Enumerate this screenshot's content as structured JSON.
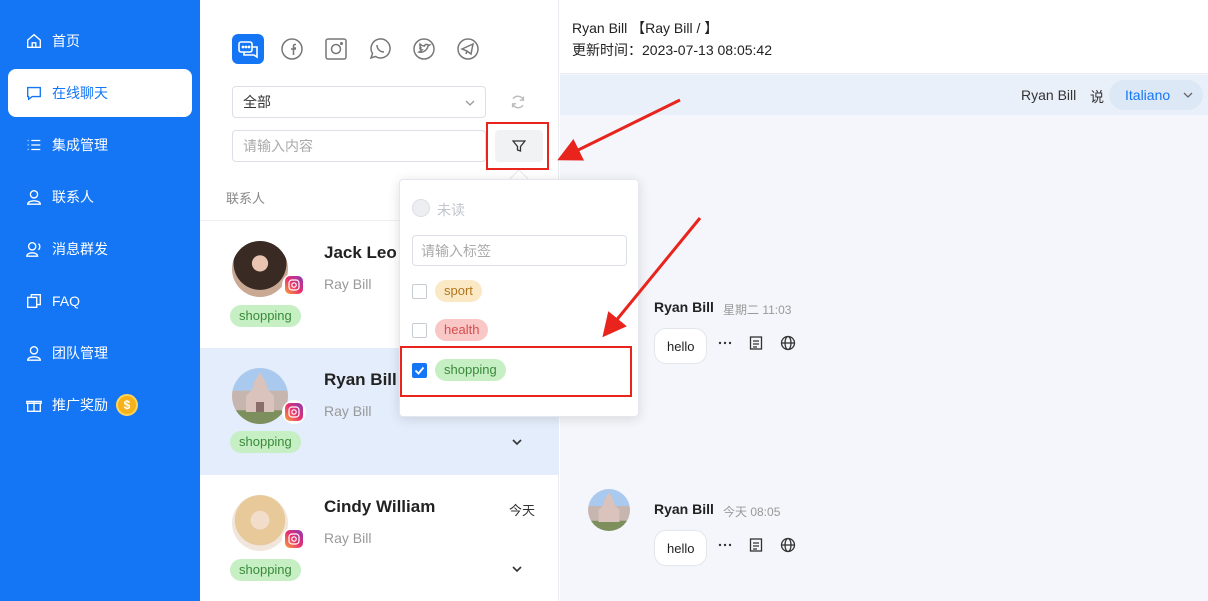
{
  "sidebar": {
    "items": [
      {
        "label": "首页",
        "icon": "home-icon"
      },
      {
        "label": "在线聊天",
        "icon": "chat-icon",
        "active": true
      },
      {
        "label": "集成管理",
        "icon": "list-icon"
      },
      {
        "label": "联系人",
        "icon": "user-icon"
      },
      {
        "label": "消息群发",
        "icon": "broadcast-icon"
      },
      {
        "label": "FAQ",
        "icon": "faq-icon"
      },
      {
        "label": "团队管理",
        "icon": "team-icon"
      },
      {
        "label": "推广奖励",
        "icon": "gift-icon"
      }
    ],
    "reward_coin": "$"
  },
  "middle": {
    "channels": [
      "chat-all-icon",
      "facebook-icon",
      "instagram-icon",
      "whatsapp-icon",
      "twitter-icon",
      "telegram-icon"
    ],
    "filter_select": "全部",
    "search_placeholder": "请输入内容",
    "section_label": "联系人",
    "contacts": [
      {
        "name": "Jack Leo",
        "sub": "Ray Bill",
        "tag": "shopping",
        "date": ""
      },
      {
        "name": "Ryan Bill",
        "sub": "Ray Bill",
        "tag": "shopping",
        "date": ""
      },
      {
        "name": "Cindy William",
        "sub": "Ray Bill",
        "tag": "shopping",
        "date": "今天"
      }
    ]
  },
  "popup": {
    "unread_label": "未读",
    "tag_placeholder": "请输入标签",
    "tags": [
      {
        "label": "sport",
        "checked": false
      },
      {
        "label": "health",
        "checked": false
      },
      {
        "label": "shopping",
        "checked": true
      }
    ]
  },
  "chat": {
    "header_title": "Ryan Bill 【Ray Bill / 】",
    "header_time": "更新时间：2023-07-13 08:05:42",
    "lang_who": "Ryan Bill",
    "lang_say": "说",
    "lang_value": "Italiano",
    "messages": [
      {
        "name": "Ryan Bill",
        "time": "星期二 11:03",
        "text": "hello"
      },
      {
        "name": "Ryan Bill",
        "time": "今天 08:05",
        "text": "hello"
      }
    ]
  },
  "colors": {
    "accent": "#1476f5",
    "annotation": "#e8241c"
  }
}
